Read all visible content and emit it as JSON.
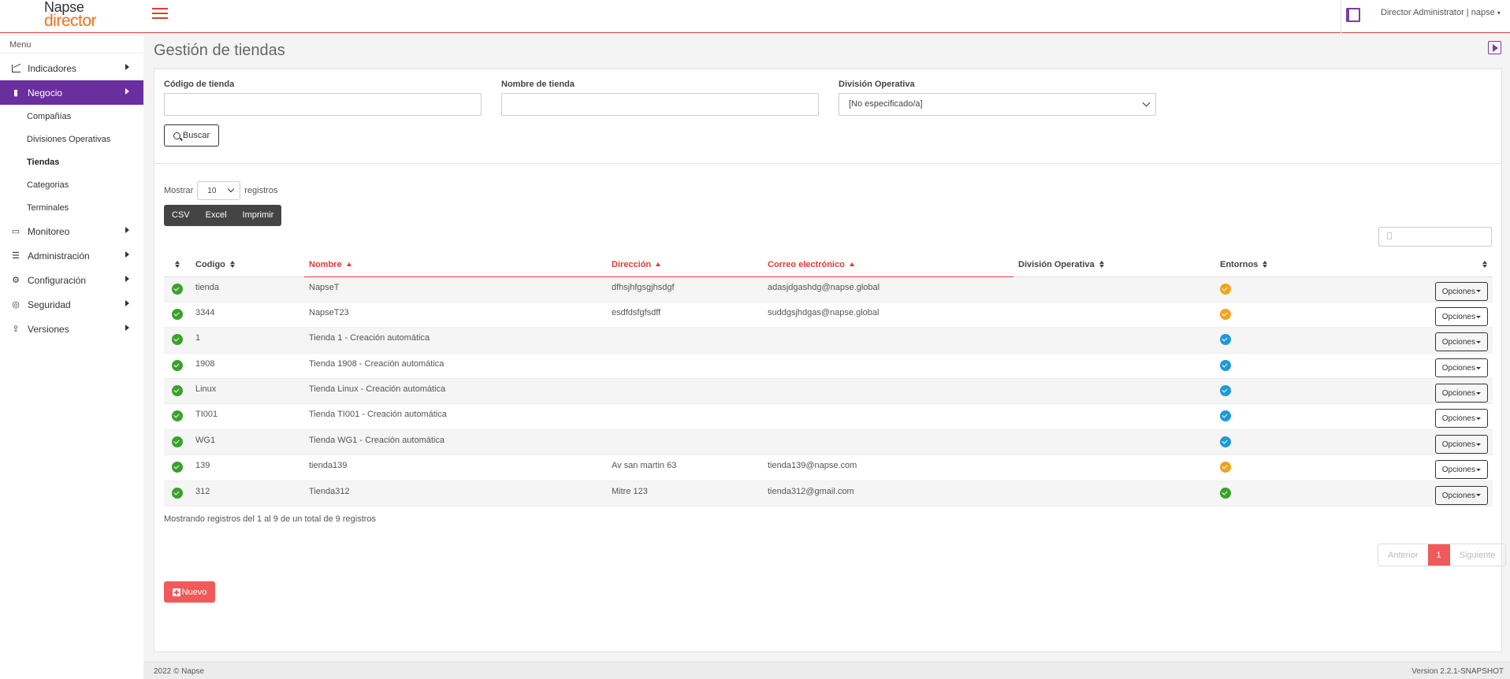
{
  "brand": {
    "line1": "Napse",
    "line2": "director"
  },
  "topbar": {
    "user": "Director Administrator | napse"
  },
  "sidebar": {
    "menu_title": "Menu",
    "items": [
      {
        "label": "Indicadores",
        "icon": "chart-line-icon"
      },
      {
        "label": "Negocio",
        "icon": "building-icon",
        "active": true
      },
      {
        "label": "Monitoreo",
        "icon": "monitor-icon"
      },
      {
        "label": "Administración",
        "icon": "list-icon"
      },
      {
        "label": "Configuración",
        "icon": "gears-icon"
      },
      {
        "label": "Seguridad",
        "icon": "fingerprint-icon"
      },
      {
        "label": "Versiones",
        "icon": "upload-icon"
      }
    ],
    "subitems": [
      "Compañías",
      "Divisiones Operativas",
      "Tiendas",
      "Categorias",
      "Terminales"
    ]
  },
  "page": {
    "title": "Gestión de tiendas"
  },
  "filters": {
    "codigo_label": "Código de tienda",
    "nombre_label": "Nombre de tienda",
    "division_label": "División Operativa",
    "division_value": "[No especificado/a]",
    "buscar": "Buscar"
  },
  "list": {
    "mostrar": "Mostrar",
    "length": "10",
    "registros": "registros",
    "buttons": [
      "CSV",
      "Excel",
      "Imprimir"
    ]
  },
  "table": {
    "headers": [
      "Codigo",
      "Nombre",
      "Dirección",
      "Correo electrónico",
      "División Operativa",
      "Entornos"
    ],
    "rows": [
      {
        "codigo": "tienda",
        "nombre": "NapseT",
        "direccion": "dfhsjhfgsgjhsdgf",
        "correo": "adasjdgashdg@napse.global",
        "division": "",
        "entorno": "orange"
      },
      {
        "codigo": "3344",
        "nombre": "NapseT23",
        "direccion": "esdfdsfgfsdff",
        "correo": "suddgsjhdgas@napse.global",
        "division": "",
        "entorno": "orange"
      },
      {
        "codigo": "1",
        "nombre": "Tienda 1 - Creación automática",
        "direccion": "",
        "correo": "",
        "division": "",
        "entorno": "blue"
      },
      {
        "codigo": "1908",
        "nombre": "Tienda 1908 - Creación automática",
        "direccion": "",
        "correo": "",
        "division": "",
        "entorno": "blue"
      },
      {
        "codigo": "Linux",
        "nombre": "Tienda Linux - Creación automática",
        "direccion": "",
        "correo": "",
        "division": "",
        "entorno": "blue"
      },
      {
        "codigo": "TI001",
        "nombre": "Tienda TI001 - Creación automática",
        "direccion": "",
        "correo": "",
        "division": "",
        "entorno": "blue"
      },
      {
        "codigo": "WG1",
        "nombre": "Tienda WG1 - Creación automática",
        "direccion": "",
        "correo": "",
        "division": "",
        "entorno": "blue"
      },
      {
        "codigo": "139",
        "nombre": "tienda139",
        "direccion": "Av san martin 63",
        "correo": "tienda139@napse.com",
        "division": "",
        "entorno": "orange"
      },
      {
        "codigo": "312",
        "nombre": "Tienda312",
        "direccion": "Mitre 123",
        "correo": "tienda312@gmail.com",
        "division": "",
        "entorno": "green"
      }
    ],
    "options_label": "Opciones"
  },
  "info": "Mostrando registros del 1 al 9 de un total de 9 registros",
  "pagination": {
    "prev": "Anterior",
    "current": "1",
    "next": "Siguiente"
  },
  "nuevo": "Nuevo",
  "footer": {
    "left": "2022 © Napse",
    "right": "Version 2.2.1-SNAPSHOT"
  },
  "colors": {
    "accent": "#e53935",
    "sidebar_active": "#6a2e9e",
    "orange": "#f0a420",
    "blue": "#1e9ad6",
    "green": "#3aa12b"
  }
}
